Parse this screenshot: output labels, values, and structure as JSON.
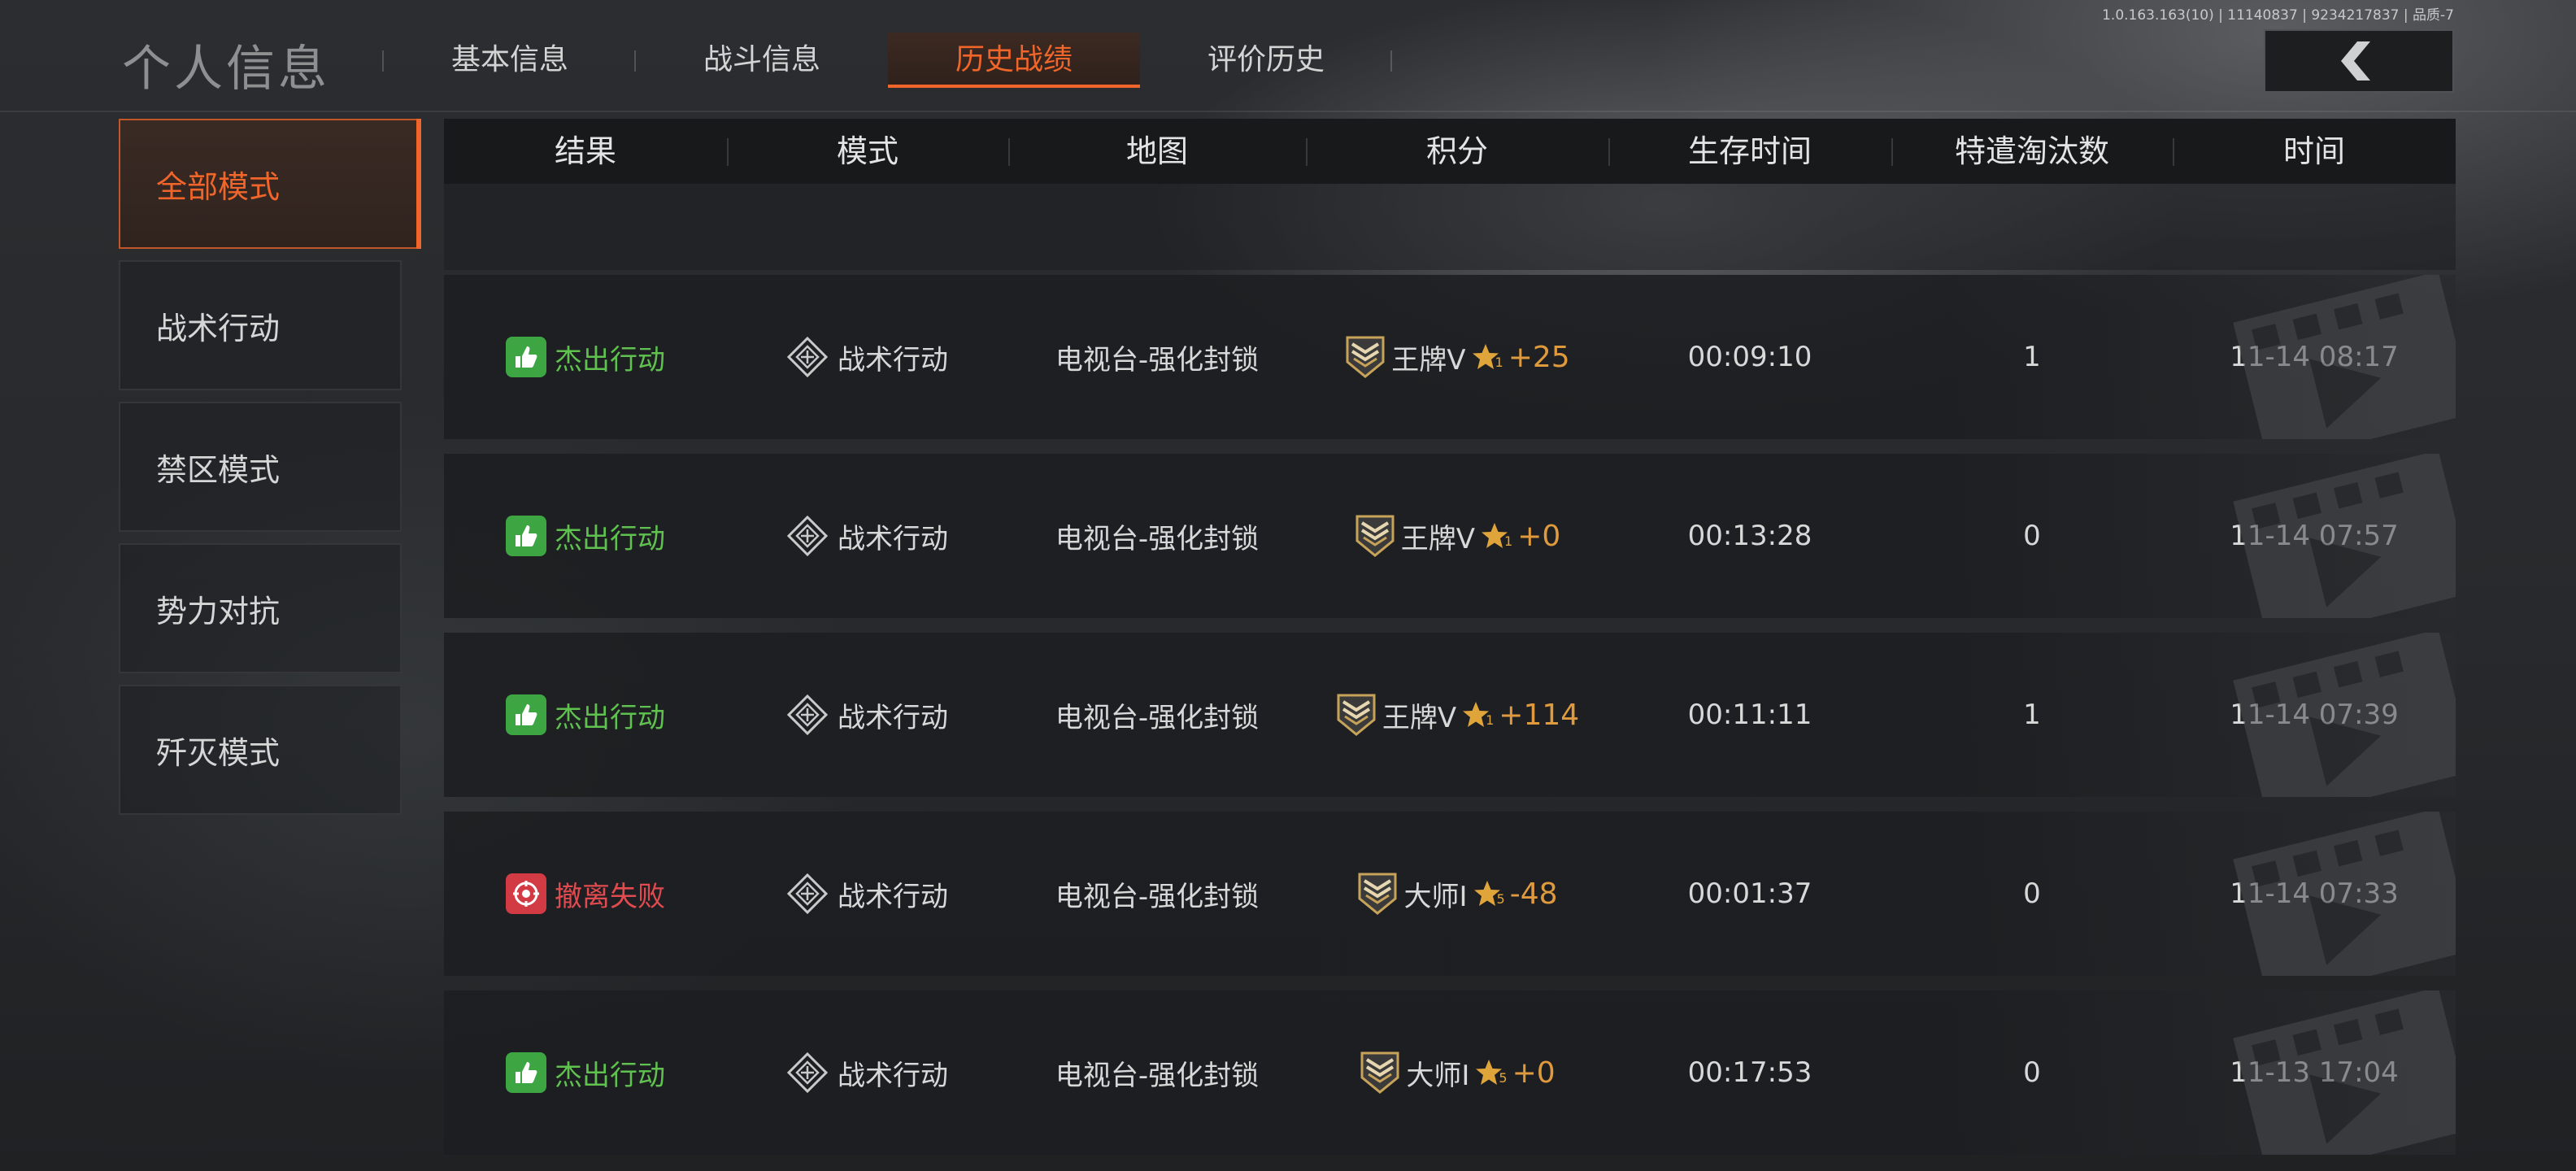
{
  "header": {
    "title": "个人信息",
    "tabs": [
      {
        "label": "基本信息",
        "active": false
      },
      {
        "label": "战斗信息",
        "active": false
      },
      {
        "label": "历史战绩",
        "active": true
      },
      {
        "label": "评价历史",
        "active": false
      }
    ],
    "version": "1.0.163.163(10) | 11140837 | 9234217837 | 品质-7",
    "back_icon": "chevron-left-icon"
  },
  "sidebar": {
    "items": [
      {
        "label": "全部模式",
        "active": true
      },
      {
        "label": "战术行动",
        "active": false
      },
      {
        "label": "禁区模式",
        "active": false
      },
      {
        "label": "势力对抗",
        "active": false
      },
      {
        "label": "歼灭模式",
        "active": false
      }
    ]
  },
  "table": {
    "columns": [
      "结果",
      "模式",
      "地图",
      "积分",
      "生存时间",
      "特遣淘汰数",
      "时间"
    ],
    "rows": [
      {
        "result": "杰出行动",
        "result_type": "win",
        "mode": "战术行动",
        "map": "电视台-强化封锁",
        "rank": "王牌V",
        "star_level": "1",
        "delta": "+25",
        "survival": "00:09:10",
        "kills": "1",
        "time": "11-14 08:17"
      },
      {
        "result": "杰出行动",
        "result_type": "win",
        "mode": "战术行动",
        "map": "电视台-强化封锁",
        "rank": "王牌V",
        "star_level": "1",
        "delta": "+0",
        "survival": "00:13:28",
        "kills": "0",
        "time": "11-14 07:57"
      },
      {
        "result": "杰出行动",
        "result_type": "win",
        "mode": "战术行动",
        "map": "电视台-强化封锁",
        "rank": "王牌V",
        "star_level": "1",
        "delta": "+114",
        "survival": "00:11:11",
        "kills": "1",
        "time": "11-14 07:39"
      },
      {
        "result": "撤离失败",
        "result_type": "lose",
        "mode": "战术行动",
        "map": "电视台-强化封锁",
        "rank": "大师I",
        "star_level": "5",
        "delta": "-48",
        "survival": "00:01:37",
        "kills": "0",
        "time": "11-14 07:33"
      },
      {
        "result": "杰出行动",
        "result_type": "win",
        "mode": "战术行动",
        "map": "电视台-强化封锁",
        "rank": "大师I",
        "star_level": "5",
        "delta": "+0",
        "survival": "00:17:53",
        "kills": "0",
        "time": "11-13 17:04"
      }
    ]
  },
  "colors": {
    "accent": "#f0652a",
    "win": "#5fc24f",
    "lose": "#e14b4f",
    "score_delta": "#e09a3e",
    "star": "#e0a53a"
  }
}
